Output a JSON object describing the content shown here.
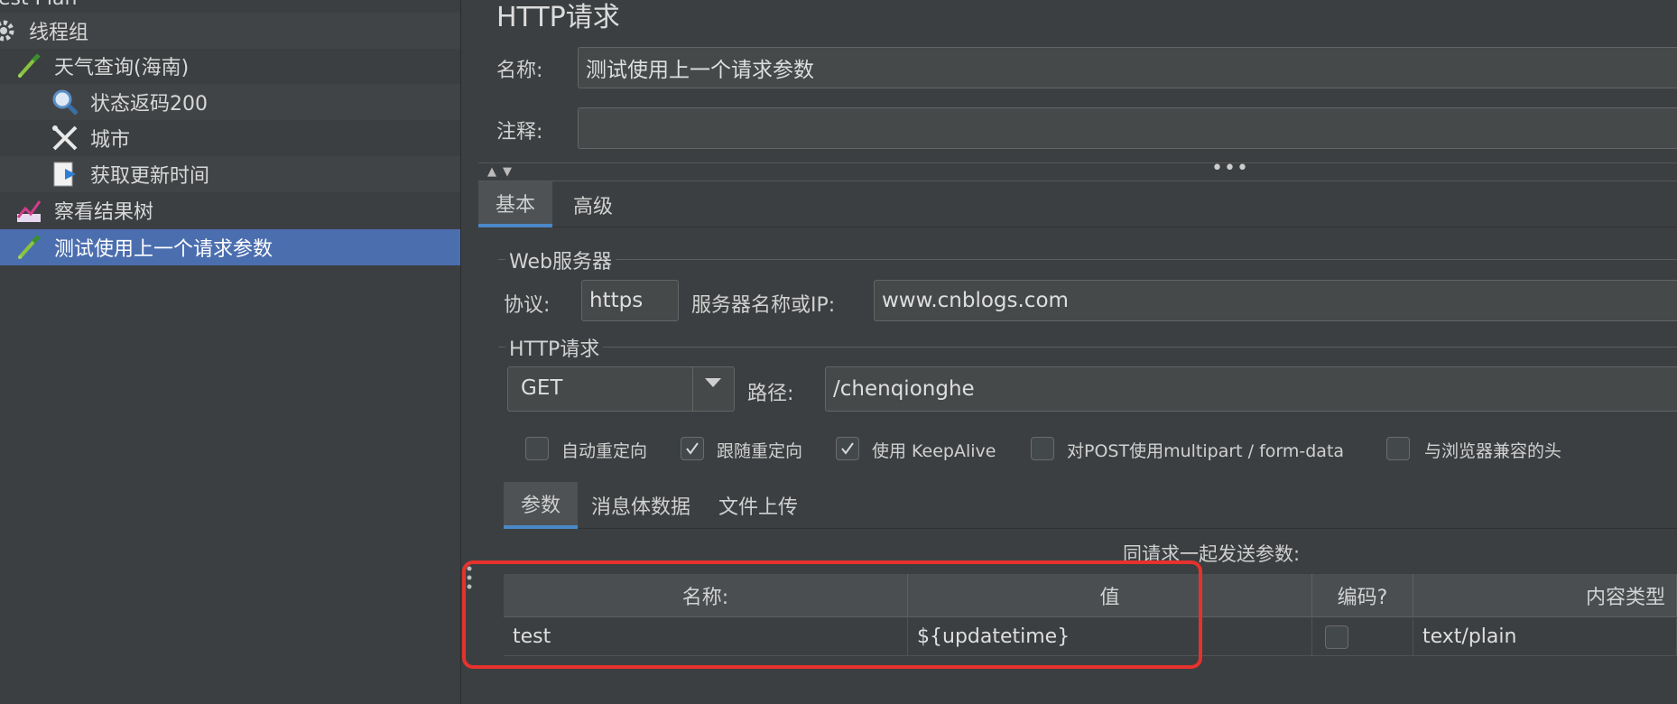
{
  "tree": {
    "root_label": "est Plan",
    "items": [
      {
        "label": "线程组",
        "icon": "gear-icon"
      },
      {
        "label": "天气查询(海南)",
        "icon": "pipette-icon"
      },
      {
        "label": "状态返码200",
        "icon": "magnifier-icon"
      },
      {
        "label": "城市",
        "icon": "tools-icon"
      },
      {
        "label": "获取更新时间",
        "icon": "document-arrow-icon"
      },
      {
        "label": "察看结果树",
        "icon": "chart-icon"
      },
      {
        "label": "测试使用上一个请求参数",
        "icon": "pipette-icon"
      }
    ]
  },
  "panel": {
    "title": "HTTP请求",
    "name_label": "名称:",
    "name_value": "测试使用上一个请求参数",
    "comment_label": "注释:",
    "comment_value": ""
  },
  "tabs": [
    "基本",
    "高级"
  ],
  "web_server": {
    "group_title": "Web服务器",
    "protocol_label": "协议:",
    "protocol_value": "https",
    "server_label": "服务器名称或IP:",
    "server_value": "www.cnblogs.com"
  },
  "http_request": {
    "group_title": "HTTP请求",
    "method": "GET",
    "path_label": "路径:",
    "path_value": "/chenqionghe"
  },
  "options": [
    {
      "label": "自动重定向",
      "checked": false
    },
    {
      "label": "跟随重定向",
      "checked": true
    },
    {
      "label": "使用 KeepAlive",
      "checked": true
    },
    {
      "label": "对POST使用multipart / form-data",
      "checked": false
    },
    {
      "label": "与浏览器兼容的头",
      "checked": false
    }
  ],
  "subtabs": [
    "参数",
    "消息体数据",
    "文件上传"
  ],
  "params": {
    "caption": "同请求一起发送参数:",
    "columns": [
      "名称:",
      "值",
      "编码?",
      "内容类型"
    ],
    "rows": [
      {
        "name": "test",
        "value": "${updatetime}",
        "encode": false,
        "content_type": "text/plain"
      }
    ]
  },
  "colors": {
    "background": "#3c3f41",
    "selection": "#4b6eaf",
    "highlight": "#e5322d",
    "tab_underline": "#4a88c7"
  }
}
